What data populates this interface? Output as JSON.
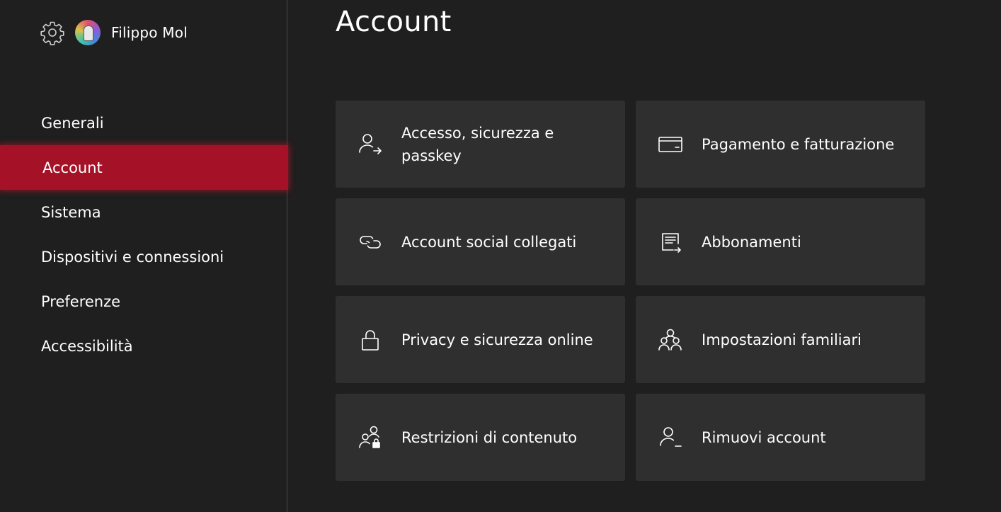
{
  "header": {
    "user_name": "Filippo Mol",
    "settings_icon": "gear-icon",
    "avatar_icon": "avatar"
  },
  "sidebar": {
    "items": [
      {
        "label": "Generali",
        "active": false
      },
      {
        "label": "Account",
        "active": true
      },
      {
        "label": "Sistema",
        "active": false
      },
      {
        "label": "Dispositivi e connessioni",
        "active": false
      },
      {
        "label": "Preferenze",
        "active": false
      },
      {
        "label": "Accessibilità",
        "active": false
      }
    ]
  },
  "main": {
    "title": "Account",
    "tiles": [
      {
        "label": "Accesso, sicurezza e passkey",
        "icon": "person-arrow-icon"
      },
      {
        "label": "Pagamento e fatturazione",
        "icon": "credit-card-icon"
      },
      {
        "label": "Account social collegati",
        "icon": "link-icon"
      },
      {
        "label": "Abbonamenti",
        "icon": "subscription-list-icon"
      },
      {
        "label": "Privacy e sicurezza online",
        "icon": "lock-icon"
      },
      {
        "label": "Impostazioni familiari",
        "icon": "family-icon"
      },
      {
        "label": "Restrizioni di contenuto",
        "icon": "people-lock-icon"
      },
      {
        "label": "Rimuovi account",
        "icon": "person-remove-icon"
      }
    ]
  },
  "colors": {
    "background": "#1f1f1f",
    "tile": "#2f2f2f",
    "accent_active": "#a51126",
    "text": "#ffffff"
  }
}
